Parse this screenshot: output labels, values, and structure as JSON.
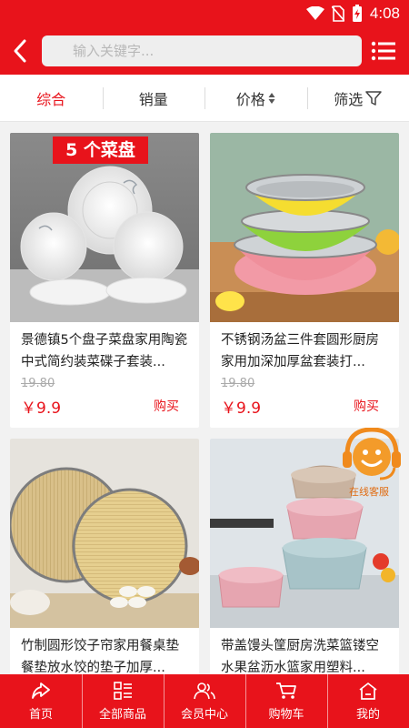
{
  "status_bar": {
    "time": "4:08",
    "icons": [
      "wifi-icon",
      "no-sim-icon",
      "battery-charging-icon"
    ]
  },
  "header": {
    "search_placeholder": "输入关键字...",
    "back_icon": "chevron-left-icon",
    "menu_icon": "list-menu-icon"
  },
  "filters": [
    {
      "label": "综合",
      "active": true
    },
    {
      "label": "销量"
    },
    {
      "label": "价格",
      "icon": "sort-arrows-icon"
    },
    {
      "label": "筛选",
      "icon": "filter-icon"
    }
  ],
  "products": [
    {
      "title": "景德镇5个盘子菜盘家用陶瓷中式简约装菜碟子套装...",
      "old_price": "19.80",
      "price": "￥9.9",
      "buy": "购买",
      "badge": "5 个菜盘"
    },
    {
      "title": "不锈钢汤盆三件套圆形厨房家用加深加厚盆套装打...",
      "old_price": "19.80",
      "price": "￥9.9",
      "buy": "购买"
    },
    {
      "title": "竹制圆形饺子帘家用餐桌垫餐垫放水饺的垫子加厚...",
      "old_price": "",
      "price": "",
      "buy": ""
    },
    {
      "title": "带盖馒头筐厨房洗菜篮镂空水果盆沥水篮家用塑料...",
      "old_price": "",
      "price": "",
      "buy": ""
    }
  ],
  "support": {
    "label": "在线客服",
    "icon": "customer-service-icon"
  },
  "tabs": [
    {
      "label": "首页",
      "icon": "home-share-icon"
    },
    {
      "label": "全部商品",
      "icon": "category-grid-icon"
    },
    {
      "label": "会员中心",
      "icon": "members-icon"
    },
    {
      "label": "购物车",
      "icon": "cart-icon"
    },
    {
      "label": "我的",
      "icon": "house-icon"
    }
  ],
  "colors": {
    "brand": "#e8131b",
    "support": "#f08a1c"
  }
}
